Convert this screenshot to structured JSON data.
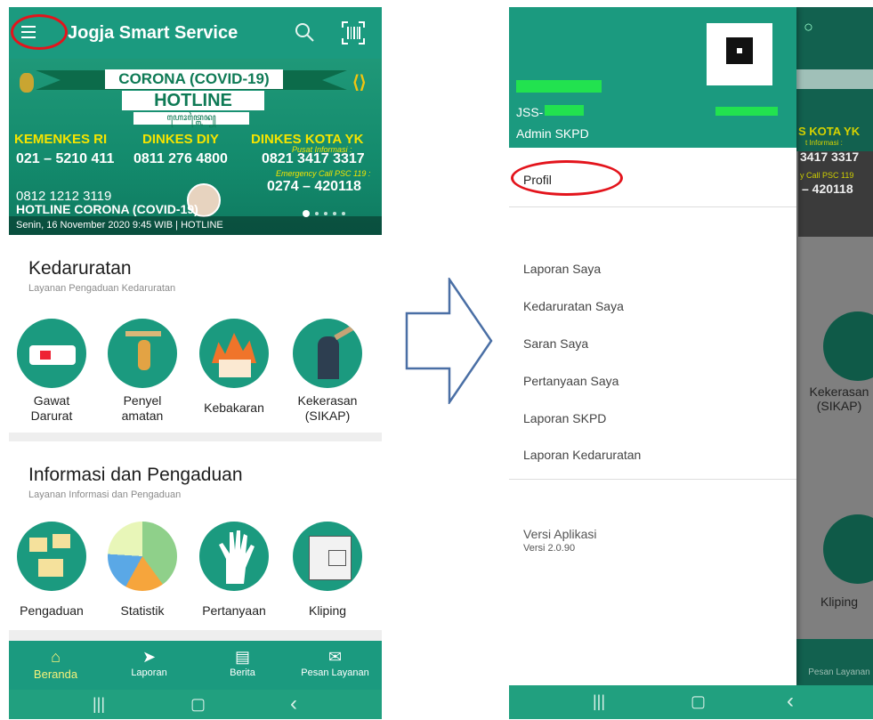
{
  "left_screen": {
    "app_title": "Jogja Smart Service",
    "banner": {
      "title_top": "CORONA (COVID-19)",
      "title_main": "HOTLINE",
      "script_text": "ꦲꦺꦴꦠ꧀ꦭꦻꦤ꧀",
      "contacts": [
        {
          "name": "KEMENKES RI",
          "phone": "021 – 5210 411"
        },
        {
          "name": "DINKES DIY",
          "phone": "0811 276 4800"
        },
        {
          "name": "DINKES KOTA YK",
          "phone": "0821 3417 3317"
        }
      ],
      "pusat_info": "Pusat Informasi :",
      "emergency_label": "Emergency Call PSC 119 :",
      "emergency_phone": "0274 – 420118",
      "extra_phone": "0812 1212 3119",
      "caption_title": "HOTLINE CORONA (COVID-19)",
      "caption_date": "Senin, 16 November 2020 9:45 WIB | HOTLINE"
    },
    "emergency_section": {
      "title": "Kedaruratan",
      "subtitle": "Layanan Pengaduan Kedaruratan",
      "items": [
        "Gawat\nDarurat",
        "Penyel\namatan",
        "Kebakaran",
        "Kekerasan\n(SIKAP)"
      ]
    },
    "info_section": {
      "title": "Informasi dan Pengaduan",
      "subtitle": "Layanan Informasi dan Pengaduan",
      "items": [
        "Pengaduan",
        "Statistik",
        "Pertanyaan",
        "Kliping"
      ]
    },
    "bottom_nav": [
      "Beranda",
      "Laporan",
      "Berita",
      "Pesan Layanan"
    ],
    "system_nav": {
      "recents": "|||",
      "home": "▢",
      "back": "‹"
    }
  },
  "right_screen": {
    "user_id": "JSS-",
    "role": "Admin SKPD",
    "menu": [
      "Profil",
      "Laporan Saya",
      "Kedaruratan Saya",
      "Saran Saya",
      "Pertanyaan Saya",
      "Laporan SKPD",
      "Laporan Kedaruratan"
    ],
    "version_label": "Versi Aplikasi",
    "version_value": "Versi 2.0.90",
    "bg_labels": {
      "kekerasan": "Kekerasan\n(SIKAP)",
      "kliping": "Kliping",
      "pesan": "Pesan Layanan",
      "kota": "S KOTA YK",
      "phone": "3417 3317",
      "emergency": "y Call PSC 119",
      "emergency_phone": "– 420118",
      "pusat": "t Informasi :"
    }
  },
  "colors": {
    "primary": "#1b9a7f",
    "highlight": "#e3141c",
    "arrow": "#4a6fa5"
  }
}
